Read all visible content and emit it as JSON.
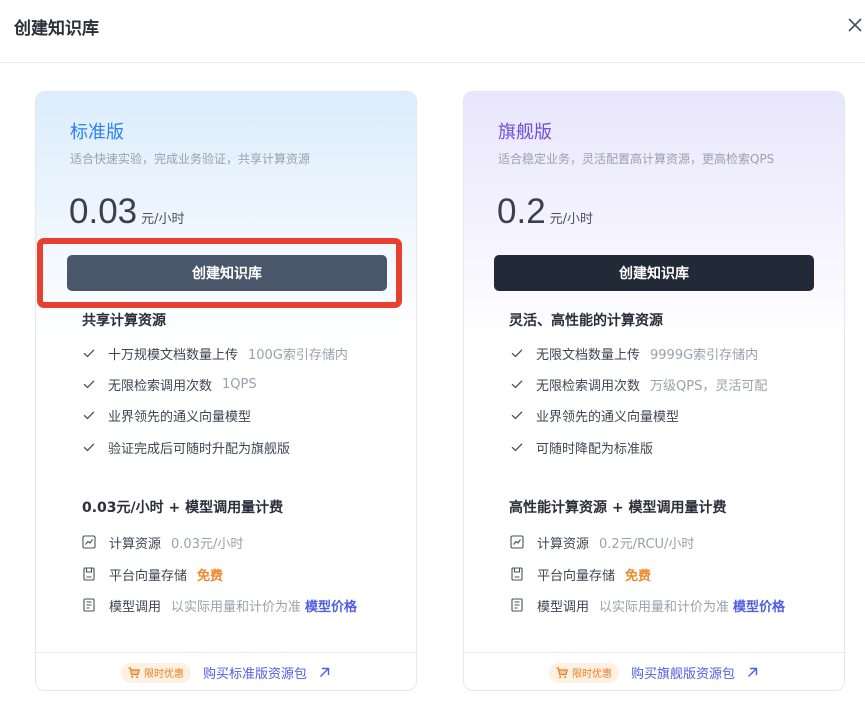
{
  "modal": {
    "title": "创建知识库"
  },
  "plans": [
    {
      "name": "标准版",
      "description": "适合快速实验，完成业务验证，共享计算资源",
      "price": "0.03",
      "price_unit": "元/小时",
      "create_label": "创建知识库",
      "section_title": "共享计算资源",
      "features": [
        {
          "main": "十万规模文档数量上传",
          "sub": "100G索引存储内"
        },
        {
          "main": "无限检索调用次数",
          "sub": "1QPS"
        },
        {
          "main": "业界领先的通义向量模型",
          "sub": ""
        },
        {
          "main": "验证完成后可随时升配为旗舰版",
          "sub": ""
        }
      ],
      "billing_title": "0.03元/小时 + 模型调用量计费",
      "billing": {
        "compute_label": "计算资源",
        "compute_value": "0.03元/小时",
        "storage_label": "平台向量存储",
        "storage_value": "免费",
        "model_label": "模型调用",
        "model_value": "以实际用量和计价为准",
        "model_link": "模型价格"
      },
      "promo_badge": "限时优惠",
      "buy_link": "购买标准版资源包"
    },
    {
      "name": "旗舰版",
      "description": "适合稳定业务，灵活配置高计算资源，更高检索QPS",
      "price": "0.2",
      "price_unit": "元/小时",
      "create_label": "创建知识库",
      "section_title": "灵活、高性能的计算资源",
      "features": [
        {
          "main": "无限文档数量上传",
          "sub": "9999G索引存储内"
        },
        {
          "main": "无限检索调用次数",
          "sub": "万级QPS，灵活可配"
        },
        {
          "main": "业界领先的通义向量模型",
          "sub": ""
        },
        {
          "main": "可随时降配为标准版",
          "sub": ""
        }
      ],
      "billing_title": "高性能计算资源 + 模型调用量计费",
      "billing": {
        "compute_label": "计算资源",
        "compute_value": "0.2元/RCU/小时",
        "storage_label": "平台向量存储",
        "storage_value": "免费",
        "model_label": "模型调用",
        "model_value": "以实际用量和计价为准",
        "model_link": "模型价格"
      },
      "promo_badge": "限时优惠",
      "buy_link": "购买旗舰版资源包"
    }
  ],
  "icons": {
    "close": "close-icon",
    "check": "check-icon",
    "compute": "chart-line-icon",
    "storage": "storage-icon",
    "model": "model-icon",
    "cart": "cart-icon",
    "arrow": "arrow-up-right-icon"
  },
  "colors": {
    "standard_accent": "#2f80f0",
    "flagship_accent": "#6d4fe0",
    "free": "#f0892a",
    "link": "#4f5ee6",
    "highlight": "#e8402f"
  }
}
